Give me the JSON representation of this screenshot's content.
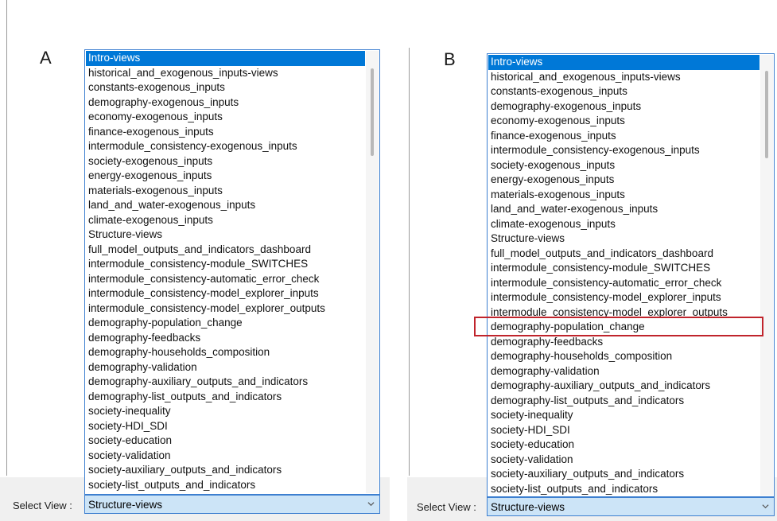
{
  "panels": [
    {
      "letter": "A",
      "select_label": "Select View :",
      "select_value": "Structure-views",
      "dropdown_items": [
        "Intro-views",
        "historical_and_exogenous_inputs-views",
        "constants-exogenous_inputs",
        "demography-exogenous_inputs",
        "economy-exogenous_inputs",
        "finance-exogenous_inputs",
        "intermodule_consistency-exogenous_inputs",
        "society-exogenous_inputs",
        "energy-exogenous_inputs",
        "materials-exogenous_inputs",
        "land_and_water-exogenous_inputs",
        "climate-exogenous_inputs",
        "Structure-views",
        "full_model_outputs_and_indicators_dashboard",
        "intermodule_consistency-module_SWITCHES",
        "intermodule_consistency-automatic_error_check",
        "intermodule_consistency-model_explorer_inputs",
        "intermodule_consistency-model_explorer_outputs",
        "demography-population_change",
        "demography-feedbacks",
        "demography-households_composition",
        "demography-validation",
        "demography-auxiliary_outputs_and_indicators",
        "demography-list_outputs_and_indicators",
        "society-inequality",
        "society-HDI_SDI",
        "society-education",
        "society-validation",
        "society-auxiliary_outputs_and_indicators",
        "society-list_outputs_and_indicators"
      ],
      "selected_item": "Intro-views",
      "highlighted_item": ""
    },
    {
      "letter": "B",
      "select_label": "Select View :",
      "select_value": "Structure-views",
      "dropdown_items": [
        "Intro-views",
        "historical_and_exogenous_inputs-views",
        "constants-exogenous_inputs",
        "demography-exogenous_inputs",
        "economy-exogenous_inputs",
        "finance-exogenous_inputs",
        "intermodule_consistency-exogenous_inputs",
        "society-exogenous_inputs",
        "energy-exogenous_inputs",
        "materials-exogenous_inputs",
        "land_and_water-exogenous_inputs",
        "climate-exogenous_inputs",
        "Structure-views",
        "full_model_outputs_and_indicators_dashboard",
        "intermodule_consistency-module_SWITCHES",
        "intermodule_consistency-automatic_error_check",
        "intermodule_consistency-model_explorer_inputs",
        "intermodule_consistency-model_explorer_outputs",
        "demography-population_change",
        "demography-feedbacks",
        "demography-households_composition",
        "demography-validation",
        "demography-auxiliary_outputs_and_indicators",
        "demography-list_outputs_and_indicators",
        "society-inequality",
        "society-HDI_SDI",
        "society-education",
        "society-validation",
        "society-auxiliary_outputs_and_indicators",
        "society-list_outputs_and_indicators"
      ],
      "selected_item": "Intro-views",
      "highlighted_item": "demography-population_change"
    }
  ],
  "colors": {
    "selection": "#0078d7",
    "highlight_box": "#c0242c",
    "select_box_bg": "#cce4f7",
    "border_blue": "#3d7fd0"
  },
  "icons": {
    "dropdown_arrow": "chevron-down-icon"
  }
}
